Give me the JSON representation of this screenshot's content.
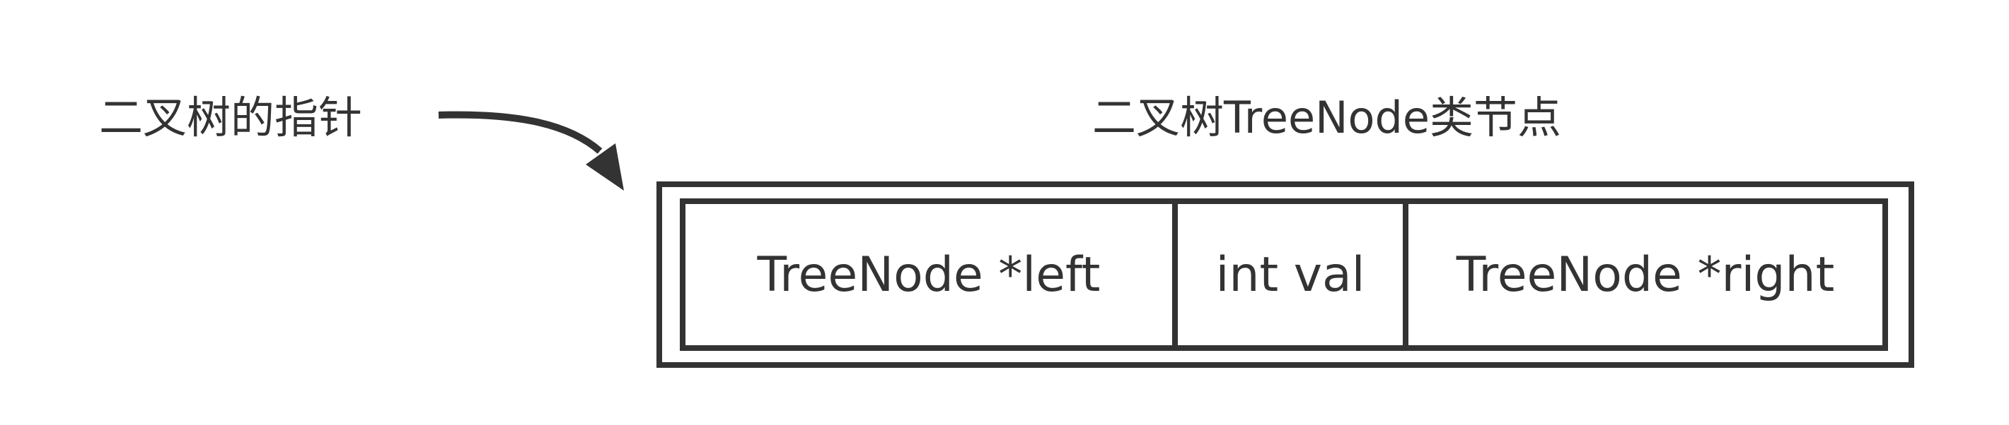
{
  "labels": {
    "pointer": "二叉树的指针",
    "node_title": "二叉树TreeNode类节点"
  },
  "node": {
    "fields": [
      {
        "label": "TreeNode *left"
      },
      {
        "label": "int val"
      },
      {
        "label": "TreeNode *right"
      }
    ]
  },
  "colors": {
    "stroke": "#333333",
    "background": "#ffffff"
  }
}
